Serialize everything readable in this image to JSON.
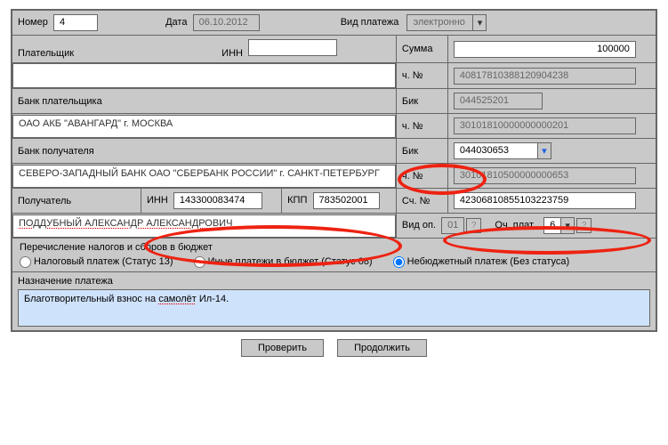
{
  "top": {
    "number_label": "Номер",
    "number_value": "4",
    "date_label": "Дата",
    "date_value": "06.10.2012",
    "ptype_label": "Вид платежа",
    "ptype_value": "электронно"
  },
  "payer": {
    "label": "Плательщик",
    "inn_label": "ИНН",
    "inn_value": "",
    "sum_label": "Сумма",
    "sum_value": "100000",
    "acc_label": "ч. №",
    "acc_value": "40817810388120904238",
    "bank_label": "Банк плательщика",
    "bank_name": "ОАО АКБ \"АВАНГАРД\" г. МОСКВА",
    "bik_label": "Бик",
    "bik_value": "044525201",
    "bank_acc_label": "ч. №",
    "bank_acc_value": "30101810000000000201"
  },
  "payee": {
    "bank_label": "Банк получателя",
    "bank_name": "СЕВЕРО-ЗАПАДНЫЙ БАНК ОАО \"СБЕРБАНК РОССИИ\" г. САНКТ-ПЕТЕРБУРГ",
    "bik_label": "Бик",
    "bik_value": "044030653",
    "bank_acc_label": "ч. №",
    "bank_acc_value": "30101810500000000653",
    "label": "Получатель",
    "inn_label": "ИНН",
    "inn_value": "143300083474",
    "kpp_label": "КПП",
    "kpp_value": "783502001",
    "acc_label": "Сч. №",
    "acc_value": "42306810855103223759",
    "name": "ПОДДУБНЫЙ АЛЕКСАНДР АЛЕКСАНДРОВИЧ"
  },
  "op": {
    "vidop_label": "Вид оп.",
    "vidop_value": "01",
    "och_label": "Оч. плат.",
    "och_value": "6"
  },
  "tax": {
    "header": "Перечисление налогов и сборов в бюджет",
    "opt1": "Налоговый платеж (Статус 13)",
    "opt2": "Иные платежи в бюджет (Статус 08)",
    "opt3": "Небюджетный платеж (Без статуса)"
  },
  "purpose": {
    "label": "Назначение платежа",
    "text_pre": "Благотворительный взнос на ",
    "text_mark": "самолёт",
    "text_post": " Ил-14."
  },
  "buttons": {
    "check": "Проверить",
    "cont": "Продолжить"
  }
}
